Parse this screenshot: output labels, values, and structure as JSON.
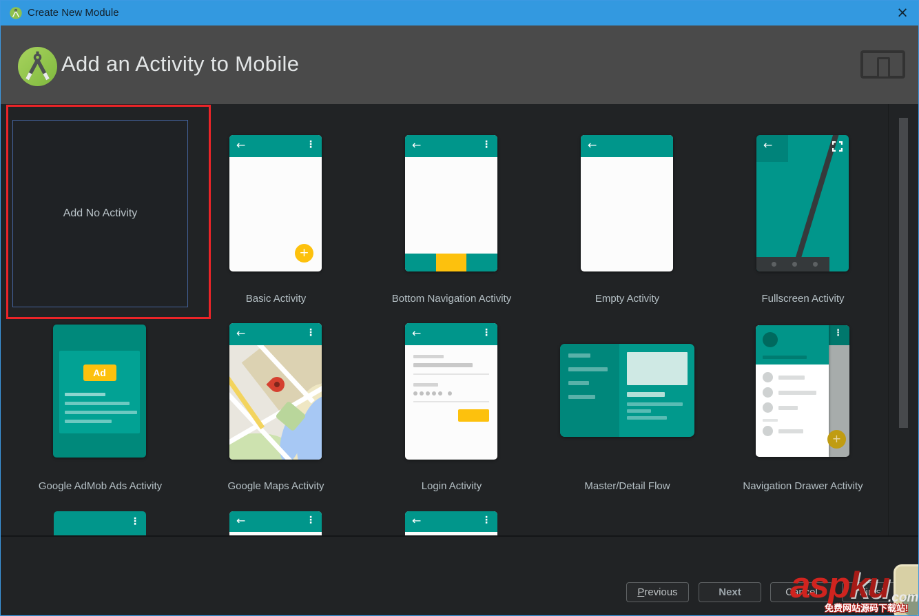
{
  "window": {
    "title": "Create New Module",
    "close_glyph": "×"
  },
  "header": {
    "title": "Add an Activity to Mobile"
  },
  "icons": {
    "back": "←",
    "menu": "⋮",
    "plus": "+",
    "android_studio_logo": "android-studio-compass",
    "device_toggle": "tablet-with-phone",
    "fullscreen": "fullscreen-corners",
    "location_pin": "map-pin"
  },
  "activities": [
    {
      "label": "Add No Activity",
      "selected": true
    },
    {
      "label": "Basic Activity"
    },
    {
      "label": "Bottom Navigation Activity"
    },
    {
      "label": "Empty Activity"
    },
    {
      "label": "Fullscreen Activity"
    },
    {
      "label": "Google AdMob Ads Activity",
      "ad_badge": "Ad"
    },
    {
      "label": "Google Maps Activity"
    },
    {
      "label": "Login Activity"
    },
    {
      "label": "Master/Detail Flow"
    },
    {
      "label": "Navigation Drawer Activity"
    }
  ],
  "footer": {
    "previous": "Previous",
    "next": "Next",
    "cancel": "Cancel",
    "finish": "Finish"
  },
  "watermark": {
    "brand_left": "asp",
    "brand_right": "ku",
    "domain": ".com",
    "tagline": "免费网站源码下载站!"
  },
  "colors": {
    "titlebar_blue": "#3399e0",
    "header_gray": "#4a4a4a",
    "content_bg": "#212325",
    "teal": "#00968b",
    "teal_dark": "#00897b",
    "accent_yellow": "#fdc10d",
    "annotation_red": "#ec2428",
    "selection_blue": "#44639c"
  }
}
